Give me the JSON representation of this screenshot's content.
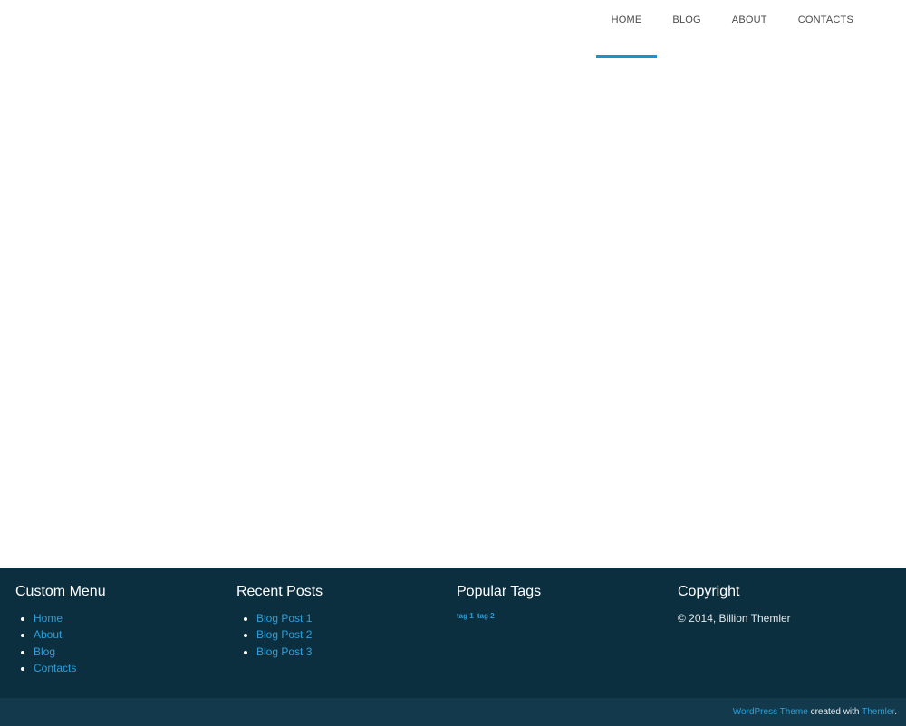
{
  "nav": {
    "items": [
      {
        "label": "HOME",
        "active": true
      },
      {
        "label": "BLOG",
        "active": false
      },
      {
        "label": "ABOUT",
        "active": false
      },
      {
        "label": "CONTACTS",
        "active": false
      }
    ]
  },
  "footer": {
    "custom_menu": {
      "title": "Custom Menu",
      "items": [
        "Home",
        "About",
        "Blog",
        "Contacts"
      ]
    },
    "recent_posts": {
      "title": "Recent Posts",
      "items": [
        "Blog Post 1",
        "Blog Post 2",
        "Blog Post 3"
      ]
    },
    "popular_tags": {
      "title": "Popular Tags",
      "tags": [
        "tag 1",
        "tag 2"
      ]
    },
    "copyright": {
      "title": "Copyright",
      "text": "© 2014, Billion Themler"
    }
  },
  "bottom_bar": {
    "link1": "WordPress Theme",
    "middle": " created with ",
    "link2": "Themler",
    "end": "."
  },
  "colors": {
    "accent": "#1e8fd0",
    "link": "#2a9fdc",
    "footer_bg": "#0c2f3f",
    "bottom_bar_bg": "#123a4c"
  }
}
